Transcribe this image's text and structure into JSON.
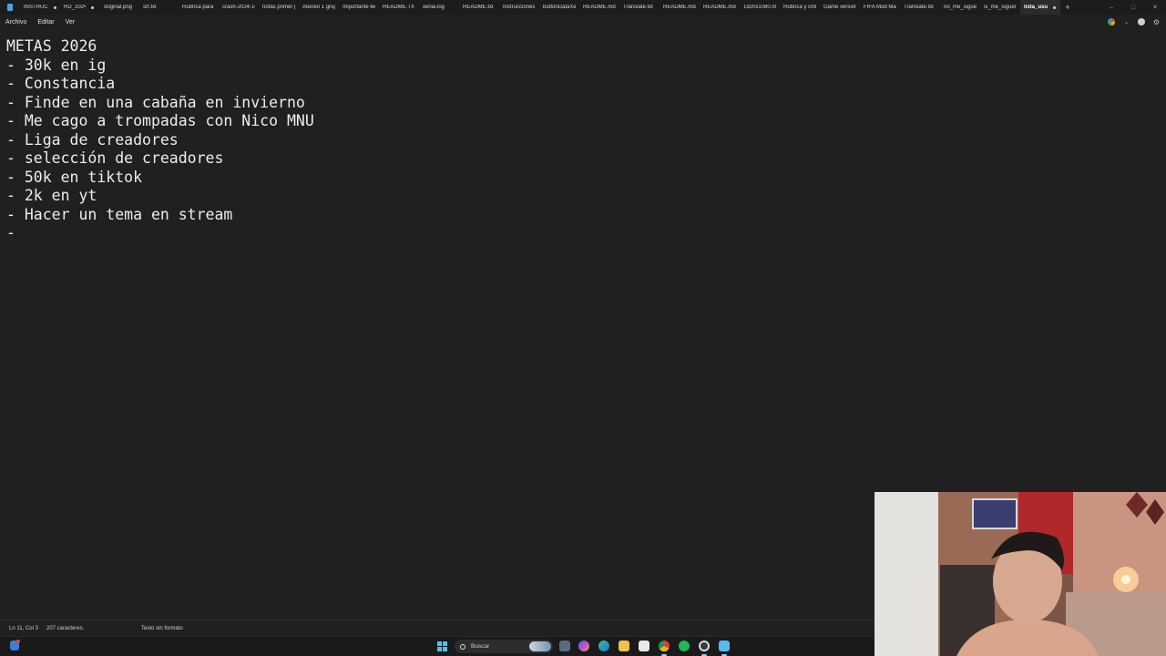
{
  "tabs": [
    {
      "label": "INSTRUC",
      "dirty": true
    },
    {
      "label": "RD_202•",
      "dirty": true
    },
    {
      "label": "original.png"
    },
    {
      "label": "srt.txt"
    },
    {
      "label": "Rúbrica para e"
    },
    {
      "label": "crash-2024-10"
    },
    {
      "label": "notas primer p"
    },
    {
      "label": "Ateneo 1 grup"
    },
    {
      "label": "Importante lee"
    },
    {
      "label": "README.TXT"
    },
    {
      "label": "xenia.log"
    },
    {
      "label": "README.txt"
    },
    {
      "label": "Instrucciones."
    },
    {
      "label": "buttonDataXe"
    },
    {
      "label": "README.md"
    },
    {
      "label": "Translate.txt"
    },
    {
      "label": "README.md"
    },
    {
      "label": "README.md"
    },
    {
      "label": "1920x1080.mn"
    },
    {
      "label": "Rúbrica y crite"
    },
    {
      "label": "Game version"
    },
    {
      "label": "FIFA Mod Mar"
    },
    {
      "label": "Translate.txt"
    },
    {
      "label": "no_me_siguen"
    },
    {
      "label": "si_me_siguen."
    },
    {
      "label": "lista_usu",
      "active": true,
      "dirty": true
    }
  ],
  "new_tab_label": "+",
  "menu": [
    "Archivo",
    "Editar",
    "Ver"
  ],
  "editor_lines": [
    "METAS 2026",
    "- 30k en ig",
    "- Constancia",
    "- Finde en una cabaña en invierno",
    "- Me cago a trompadas con Nico MNU",
    "- Liga de creadores",
    "- selección de creadores",
    "- 50k en tiktok",
    "- 2k en yt",
    "- Hacer un tema en stream",
    "-"
  ],
  "status": {
    "position": "Ln 11, Col 3",
    "characters": "207 caracteres.",
    "format": "Texto sin formato"
  },
  "taskbar": {
    "search_placeholder": "Buscar",
    "icons": [
      "weather-icon",
      "windows-start-icon",
      "file-explorer-icon",
      "copilot-icon",
      "edge-icon",
      "folder-icon",
      "store-icon",
      "chrome-icon",
      "spotify-icon",
      "obs-icon",
      "notepad-icon"
    ]
  },
  "colors": {
    "editor_bg": "#202020",
    "tabbar_bg": "#1c1c1c",
    "text": "#ededed",
    "accent": "#4cc2ff"
  }
}
